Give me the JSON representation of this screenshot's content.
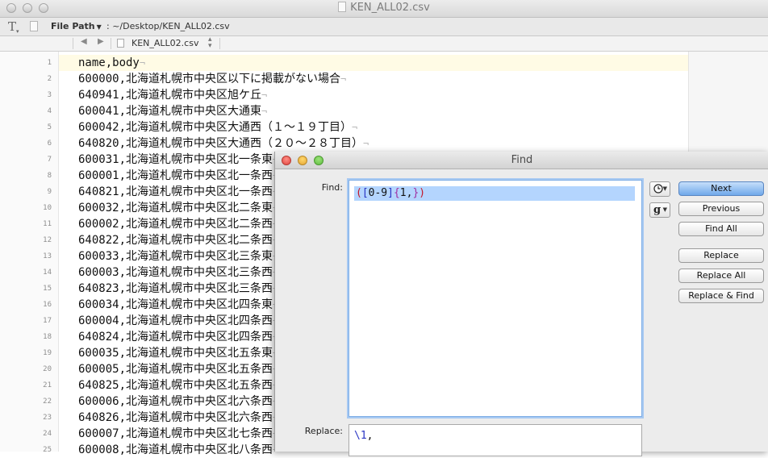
{
  "window": {
    "title": "KEN_ALL02.csv"
  },
  "toolbar": {
    "path_label": "File Path",
    "path_value": ": ~/Desktop/KEN_ALL02.csv"
  },
  "navbar": {
    "back": "◀",
    "forward": "▶",
    "tab_name": "KEN_ALL02.csv"
  },
  "editor": {
    "eol_mark": "¬",
    "line_numbers": [
      "1",
      "2",
      "3",
      "4",
      "5",
      "6",
      "7",
      "8",
      "9",
      "10",
      "11",
      "12",
      "13",
      "14",
      "15",
      "16",
      "17",
      "18",
      "19",
      "20",
      "21",
      "22",
      "23",
      "24",
      "25"
    ],
    "lines": [
      "name,body",
      "600000,北海道札幌市中央区以下に掲載がない場合",
      "640941,北海道札幌市中央区旭ケ丘",
      "600041,北海道札幌市中央区大通東",
      "600042,北海道札幌市中央区大通西（１〜１９丁目）",
      "640820,北海道札幌市中央区大通西（２０〜２８丁目）",
      "600031,北海道札幌市中央区北一条東",
      "600001,北海道札幌市中央区北一条西",
      "640821,北海道札幌市中央区北一条西",
      "600032,北海道札幌市中央区北二条東",
      "600002,北海道札幌市中央区北二条西",
      "640822,北海道札幌市中央区北二条西",
      "600033,北海道札幌市中央区北三条東",
      "600003,北海道札幌市中央区北三条西",
      "640823,北海道札幌市中央区北三条西",
      "600034,北海道札幌市中央区北四条東",
      "600004,北海道札幌市中央区北四条西",
      "640824,北海道札幌市中央区北四条西",
      "600035,北海道札幌市中央区北五条東",
      "600005,北海道札幌市中央区北五条西",
      "640825,北海道札幌市中央区北五条西",
      "600006,北海道札幌市中央区北六条西",
      "640826,北海道札幌市中央区北六条西",
      "600007,北海道札幌市中央区北七条西",
      "600008,北海道札幌市中央区北八条西"
    ]
  },
  "find_dialog": {
    "title": "Find",
    "find_label": "Find:",
    "find_value": {
      "p1": "(",
      "b1": "[",
      "t1": "0-9",
      "b2": "]",
      "c1": "{",
      "t2": "1,",
      "c2": "}",
      "p2": ")"
    },
    "replace_label": "Replace:",
    "replace_value": {
      "esc": "\\1",
      "rest": ","
    },
    "google_icon_text": "g",
    "buttons": {
      "next": "Next",
      "previous": "Previous",
      "find_all": "Find All",
      "replace": "Replace",
      "replace_all": "Replace All",
      "replace_and_find": "Replace & Find"
    }
  }
}
